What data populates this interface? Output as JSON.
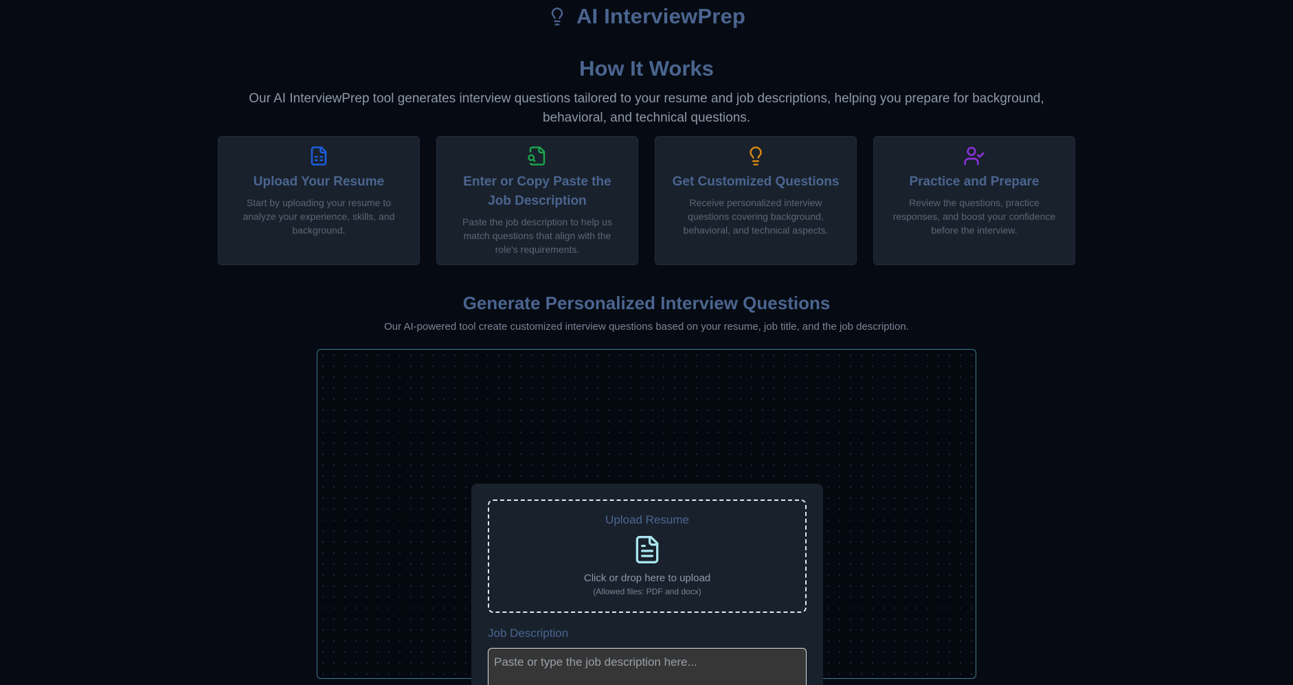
{
  "header": {
    "app_title": "AI InterviewPrep",
    "logo_icon": "lightbulb-icon"
  },
  "how_it_works": {
    "title": "How It Works",
    "description": "Our AI InterviewPrep tool generates interview questions tailored to your resume and job descriptions, helping you prepare for background, behavioral, and technical questions.",
    "steps": [
      {
        "icon": "file-spreadsheet-icon",
        "icon_color": "#1d5fe0",
        "title": "Upload Your Resume",
        "description": "Start by uploading your resume to analyze your experience, skills, and background."
      },
      {
        "icon": "file-search-icon",
        "icon_color": "#1ea34d",
        "title": "Enter or Copy Paste the Job Description",
        "description": "Paste the job description to help us match questions that align with the role's requirements."
      },
      {
        "icon": "lightbulb-icon",
        "icon_color": "#d7870f",
        "title": "Get Customized Questions",
        "description": "Receive personalized interview questions covering background, behavioral, and technical aspects."
      },
      {
        "icon": "user-check-icon",
        "icon_color": "#8a2fd6",
        "title": "Practice and Prepare",
        "description": "Review the questions, practice responses, and boost your confidence before the interview."
      }
    ]
  },
  "generator": {
    "title": "Generate Personalized Interview Questions",
    "description": "Our AI-powered tool create customized interview questions based on your resume, job title, and the job description.",
    "upload": {
      "label": "Upload Resume",
      "icon": "file-text-icon",
      "icon_color": "#a8e6ee",
      "main_text": "Click or drop here to upload",
      "sub_text": "(Allowed files: PDF and docx)"
    },
    "job_description": {
      "label": "Job Description",
      "placeholder": "Paste or type the job description here...",
      "value": ""
    }
  },
  "colors": {
    "background": "#060b13",
    "heading": "#4b6590",
    "card": "#19212c",
    "panel_border": "#3d7b93"
  }
}
